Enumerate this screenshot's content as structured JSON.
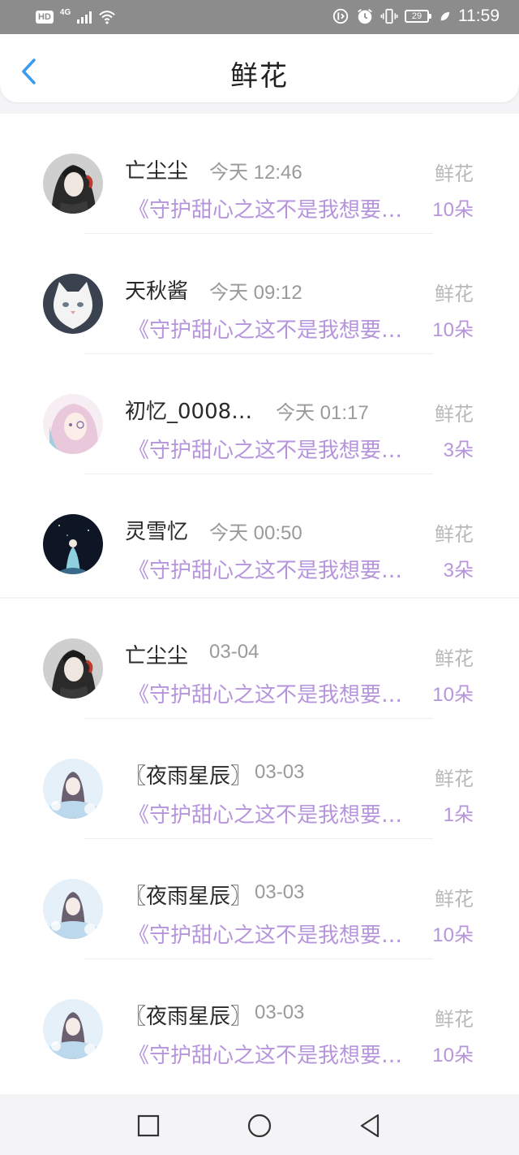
{
  "status_bar": {
    "hd": "HD",
    "network": "4G",
    "battery": "29",
    "time": "11:59"
  },
  "header": {
    "title": "鲜花",
    "back_icon": "chevron-left-icon"
  },
  "accent_color": "#b695dc",
  "back_color": "#3b9bf0",
  "items": [
    {
      "name": "亡尘尘",
      "time": "今天 12:46",
      "kind": "鲜花",
      "book": "《守护甜心之这不是我想要…",
      "count": "10朵"
    },
    {
      "name": "天秋酱",
      "time": "今天 09:12",
      "kind": "鲜花",
      "book": "《守护甜心之这不是我想要…",
      "count": "10朵"
    },
    {
      "name": "初忆_0008…",
      "time": "今天 01:17",
      "kind": "鲜花",
      "book": "《守护甜心之这不是我想要…",
      "count": "3朵"
    },
    {
      "name": "灵雪忆",
      "time": "今天 00:50",
      "kind": "鲜花",
      "book": "《守护甜心之这不是我想要…",
      "count": "3朵"
    },
    {
      "name": "亡尘尘",
      "time": "03-04",
      "kind": "鲜花",
      "book": "《守护甜心之这不是我想要…",
      "count": "10朵"
    },
    {
      "name": "〖夜雨星辰〗",
      "time": "03-03",
      "kind": "鲜花",
      "book": "《守护甜心之这不是我想要…",
      "count": "1朵"
    },
    {
      "name": "〖夜雨星辰〗",
      "time": "03-03",
      "kind": "鲜花",
      "book": "《守护甜心之这不是我想要…",
      "count": "10朵"
    },
    {
      "name": "〖夜雨星辰〗",
      "time": "03-03",
      "kind": "鲜花",
      "book": "《守护甜心之这不是我想要…",
      "count": "10朵"
    }
  ],
  "nav": {
    "recents_icon": "square-icon",
    "home_icon": "circle-icon",
    "back_icon": "triangle-back-icon"
  }
}
